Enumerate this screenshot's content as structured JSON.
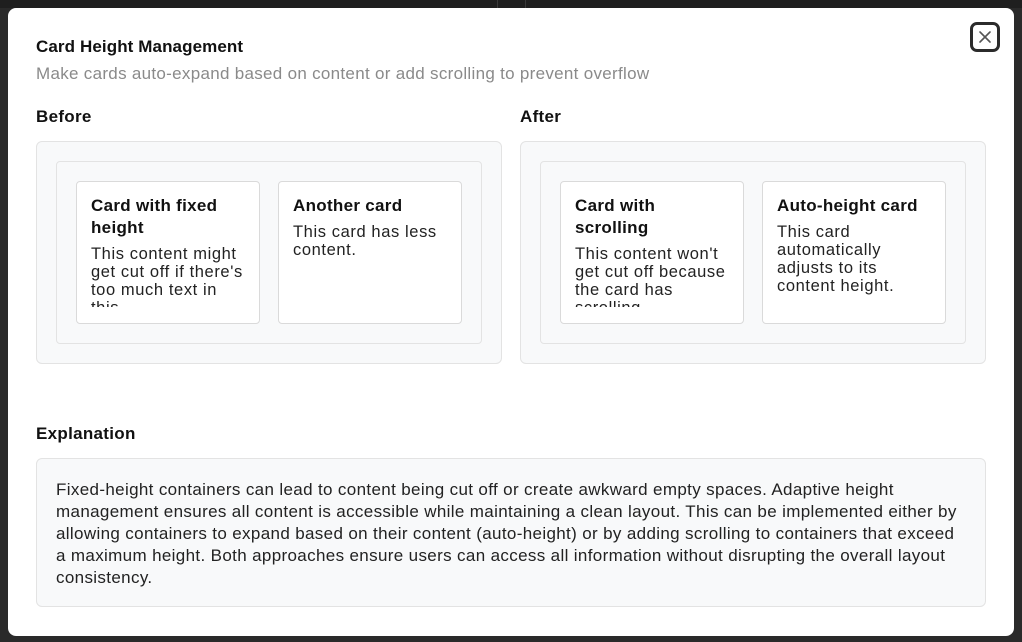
{
  "modal": {
    "title": "Card Height Management",
    "subtitle": "Make cards auto-expand based on content or add scrolling to prevent overflow",
    "close_icon": "close-icon"
  },
  "before": {
    "heading": "Before",
    "cards": [
      {
        "title": "Card with fixed height",
        "body": "This content might get cut off if there's too much text in this"
      },
      {
        "title": "Another card",
        "body": "This card has less content."
      }
    ]
  },
  "after": {
    "heading": "After",
    "cards": [
      {
        "title": "Card with scrolling",
        "body": "This content won't get cut off because the card has scrolling"
      },
      {
        "title": "Auto-height card",
        "body": "This card automatically adjusts to its content height."
      }
    ]
  },
  "explanation": {
    "heading": "Explanation",
    "text": "Fixed-height containers can lead to content being cut off or create awkward empty spaces. Adaptive height management ensures all content is accessible while maintaining a clean layout. This can be implemented either by allowing containers to expand based on their content (auto-height) or by adding scrolling to containers that exceed a maximum height. Both approaches ensure users can access all information without disrupting the overall layout consistency."
  },
  "colors": {
    "backdrop": "#2a2a2a",
    "panel_bg": "#f8f9fa",
    "border": "#e3e3e3",
    "subtitle": "#8a8a8a"
  }
}
